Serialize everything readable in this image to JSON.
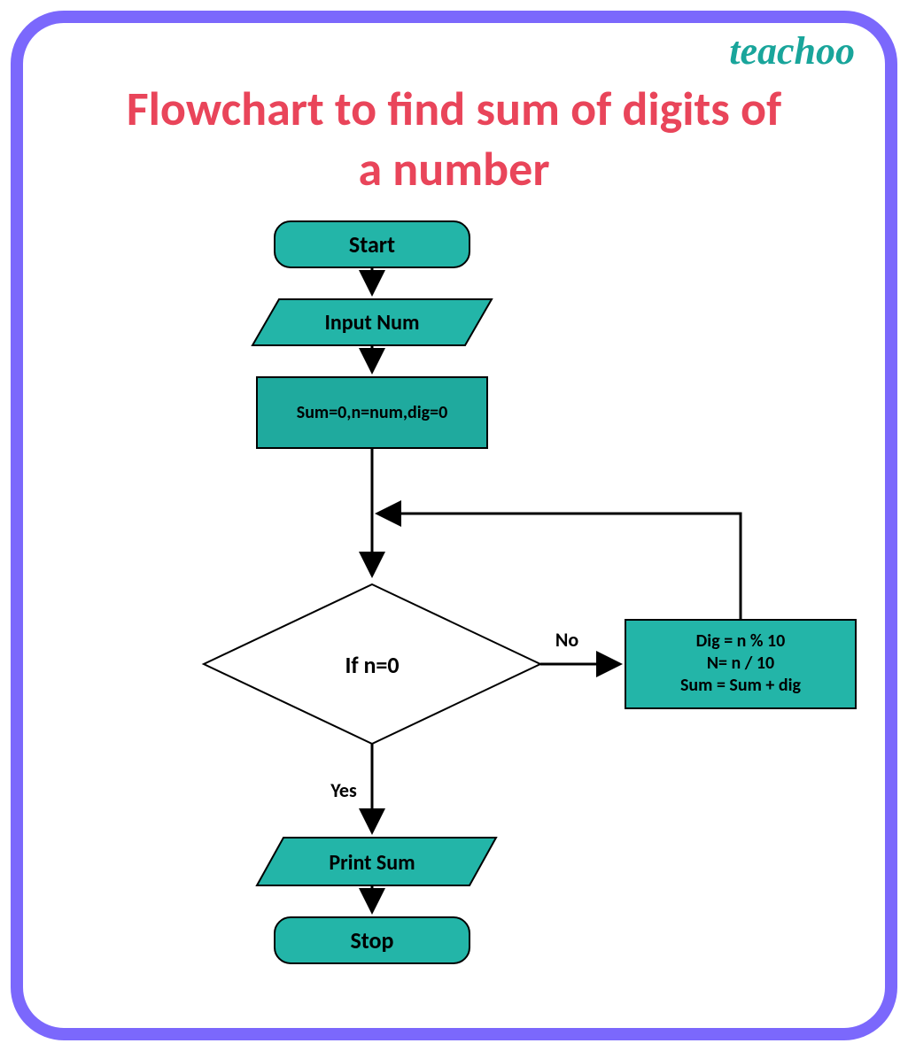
{
  "brand": "teachoo",
  "title_line1": "Flowchart to find sum of digits of",
  "title_line2": "a number",
  "nodes": {
    "start": "Start",
    "input": "Input Num",
    "init": "Sum=0,n=num,dig=0",
    "decision": "If  n=0",
    "process_l1": "Dig = n % 10",
    "process_l2": "N= n / 10",
    "process_l3": "Sum =  Sum + dig",
    "print": "Print Sum",
    "stop": "Stop"
  },
  "labels": {
    "no": "No",
    "yes": "Yes"
  },
  "colors": {
    "frame": "#7B68FC",
    "title": "#E9455A",
    "brand": "#19A59B",
    "shape": "#23B5A8"
  }
}
